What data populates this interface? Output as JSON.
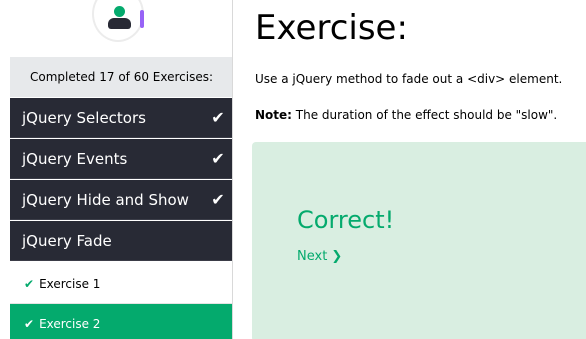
{
  "sidebar": {
    "progress_text": "Completed 17 of 60 Exercises:",
    "items": [
      {
        "label": "jQuery Selectors",
        "completed_icon": "checkmark-icon"
      },
      {
        "label": "jQuery Events",
        "completed_icon": "checkmark-icon"
      },
      {
        "label": "jQuery Hide and Show",
        "completed_icon": "checkmark-icon"
      },
      {
        "label": "jQuery Fade",
        "completed_icon": ""
      }
    ],
    "subitems": [
      {
        "label": "Exercise 1"
      },
      {
        "label": "Exercise 2"
      }
    ]
  },
  "main": {
    "title": "Exercise:",
    "instruction": "Use a jQuery method to fade out a <div> element.",
    "note_label": "Note:",
    "note_text": " The duration of the effect should be \"slow\".",
    "result": {
      "status": "Correct!",
      "next_label": "Next ❯"
    }
  },
  "colors": {
    "accent": "#04aa6d",
    "menu_dark": "#282a35",
    "progress_bg": "#e7e9eb",
    "result_bg": "#d9eee1"
  }
}
